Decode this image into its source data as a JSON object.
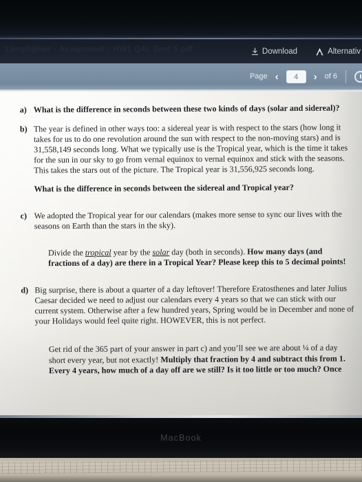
{
  "window": {
    "device_label": "MacBook"
  },
  "app_header": {
    "faint_title": "Lamplighter - Assignment - HW1 Q4c Sent 5.pdf",
    "download_label": "Download",
    "download_icon": "download-icon",
    "alternative_label": "Alternativ",
    "alternative_icon": "accessibility-a-icon"
  },
  "toolbar": {
    "page_label": "Page",
    "prev_icon": "chevron-left-icon",
    "next_icon": "chevron-right-icon",
    "current_page": "4",
    "of_label": "of 6",
    "total_pages": 6,
    "rotate_icon": "rotate-icon"
  },
  "document": {
    "items": [
      {
        "marker": "a)",
        "bold": true,
        "text": "What is the difference in seconds between these two kinds of days (solar and sidereal)?"
      },
      {
        "marker": "b)",
        "bold": false,
        "text": "The year is defined in other ways too: a sidereal year is with respect to the stars (how long it takes for us to do one revolution around the sun with respect to the non-moving stars) and is 31,558,149 seconds long. What we typically use is the Tropical year, which is the time it takes for the sun in our sky to go from vernal equinox to vernal equinox and stick with the seasons. This takes the stars out of the picture. The Tropical year is 31,556,925 seconds long."
      }
    ],
    "b_question": "What is the difference in seconds between the sidereal and Tropical year?",
    "item_c": {
      "marker": "c)",
      "text": "We adopted the Tropical year for our calendars (makes more sense to sync our lives with the seasons on Earth than the stars in the sky)."
    },
    "c_followup": {
      "lead": "Divide the ",
      "em1": "tropical",
      "mid1": " year by the ",
      "em2": "solar",
      "mid2": " day (both in seconds). ",
      "bold": "How many days (and fractions of a day) are there in a Tropical Year? Please keep this to 5 decimal points!"
    },
    "item_d": {
      "marker": "d)",
      "text": "Big surprise, there is about a quarter of a day leftover! Therefore Eratosthenes and later Julius Caesar decided we need to adjust our calendars every 4 years so that we can stick with our current system. Otherwise after a few hundred years, Spring would be in December and none of your Holidays would feel quite right. HOWEVER, this is not perfect."
    },
    "d_followup": {
      "normal": "Get rid of the 365 part of your answer in part c) and you’ll see we are about ¼ of a day short every year, but not exactly! ",
      "bold": "Multiply that fraction by 4 and subtract this from 1. Every 4 years, how much of a day off are we still? Is it too little or too much? Once"
    },
    "sidereal_year_seconds": "31,558,149",
    "tropical_year_seconds": "31,556,925"
  },
  "colors": {
    "toolbar_bg": "#7b8fa4",
    "header_bg": "#1b212c",
    "page_bg": "#f3f2ee",
    "text": "#1d1f22"
  }
}
